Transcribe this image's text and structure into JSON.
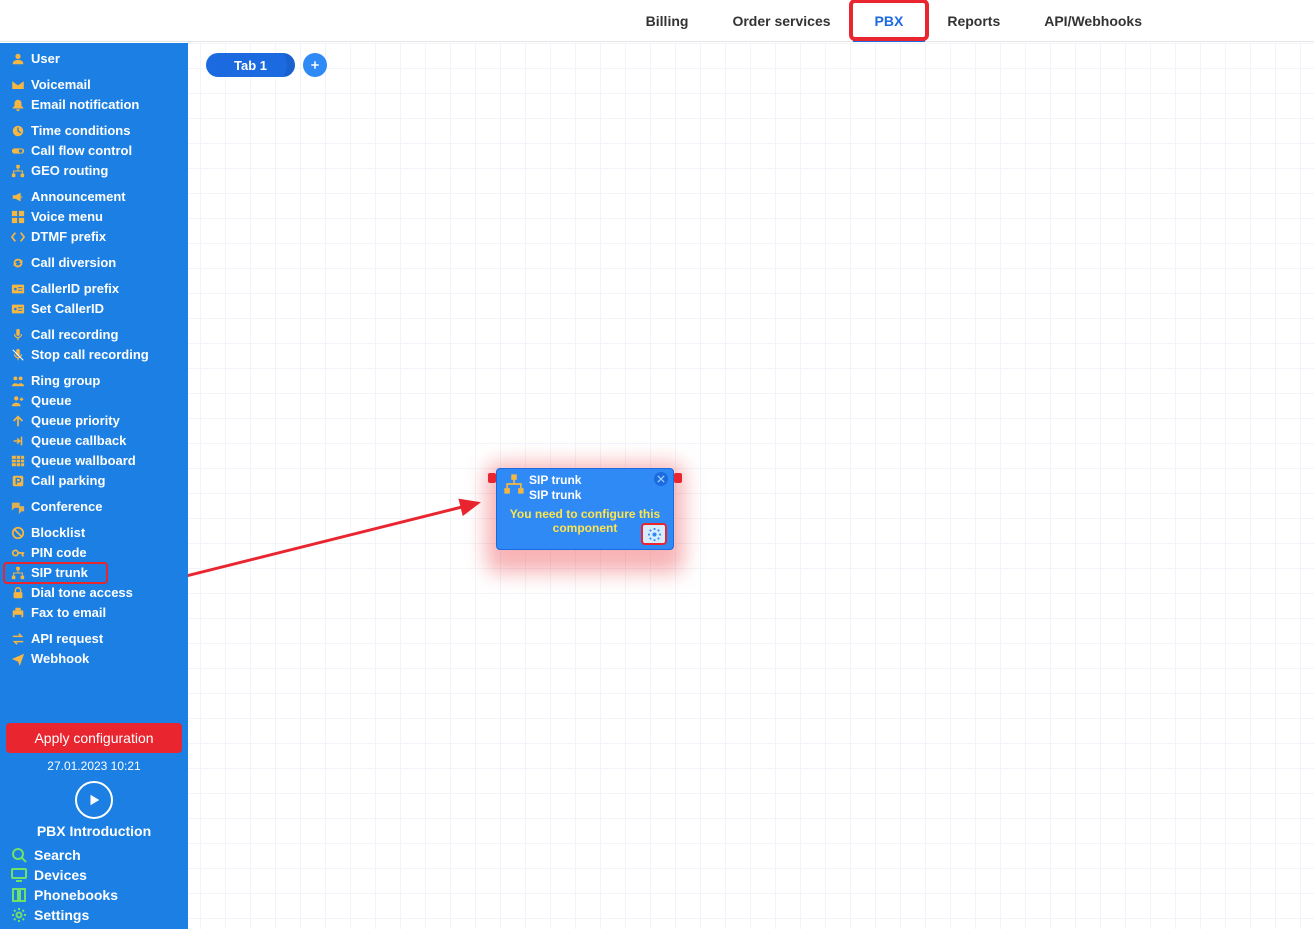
{
  "topnav": {
    "billing": "Billing",
    "order": "Order services",
    "pbx": "PBX",
    "reports": "Reports",
    "api": "API/Webhooks"
  },
  "sidebar": {
    "items": [
      {
        "id": "user",
        "label": "User"
      },
      {
        "id": "voicemail",
        "label": "Voicemail"
      },
      {
        "id": "emailnotif",
        "label": "Email notification"
      },
      {
        "id": "timecond",
        "label": "Time conditions"
      },
      {
        "id": "callflow",
        "label": "Call flow control"
      },
      {
        "id": "georouting",
        "label": "GEO routing"
      },
      {
        "id": "announcement",
        "label": "Announcement"
      },
      {
        "id": "voicemenu",
        "label": "Voice menu"
      },
      {
        "id": "dtmf",
        "label": "DTMF prefix"
      },
      {
        "id": "diversion",
        "label": "Call diversion"
      },
      {
        "id": "calleridprefix",
        "label": "CallerID prefix"
      },
      {
        "id": "setcallerid",
        "label": "Set CallerID"
      },
      {
        "id": "callrec",
        "label": "Call recording"
      },
      {
        "id": "stopcallrec",
        "label": "Stop call recording"
      },
      {
        "id": "ringgroup",
        "label": "Ring group"
      },
      {
        "id": "queue",
        "label": "Queue"
      },
      {
        "id": "queuepriority",
        "label": "Queue priority"
      },
      {
        "id": "queuecallback",
        "label": "Queue callback"
      },
      {
        "id": "queuewallboard",
        "label": "Queue wallboard"
      },
      {
        "id": "callparking",
        "label": "Call parking"
      },
      {
        "id": "conference",
        "label": "Conference"
      },
      {
        "id": "blocklist",
        "label": "Blocklist"
      },
      {
        "id": "pincode",
        "label": "PIN code"
      },
      {
        "id": "siptrunk",
        "label": "SIP trunk"
      },
      {
        "id": "dialtone",
        "label": "Dial tone access"
      },
      {
        "id": "faxemail",
        "label": "Fax to email"
      },
      {
        "id": "apirequest",
        "label": "API request"
      },
      {
        "id": "webhook",
        "label": "Webhook"
      }
    ],
    "apply_label": "Apply configuration",
    "apply_ts": "27.01.2023 10:21",
    "intro": "PBX Introduction",
    "footer": {
      "search": "Search",
      "devices": "Devices",
      "phonebooks": "Phonebooks",
      "settings": "Settings"
    }
  },
  "canvas": {
    "tab_label": "Tab 1"
  },
  "node": {
    "title": "SIP trunk",
    "subtitle": "SIP trunk",
    "warn": "You need to configure this component"
  }
}
